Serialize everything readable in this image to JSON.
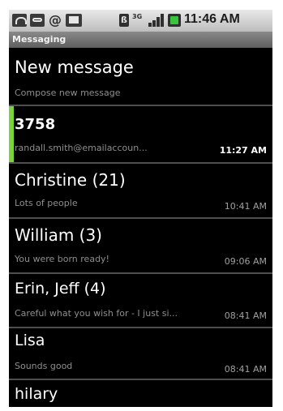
{
  "status_bar": {
    "icons": [
      "phone-icon",
      "voicemail-icon",
      "at-icon",
      "sd-card-icon",
      "bluetooth-icon",
      "3g-icon",
      "signal-icon",
      "battery-icon"
    ],
    "bluetooth_glyph": "ß",
    "network": "3G",
    "at_glyph": "@",
    "time": "11:46 AM"
  },
  "app_title": "Messaging",
  "new_message": {
    "label": "New message",
    "sublabel": "Compose new message"
  },
  "threads": [
    {
      "name": "3758",
      "preview": "randall.smith@emailaccoun...",
      "time": "11:27 AM",
      "unread": true
    },
    {
      "name": "Christine (21)",
      "preview": "Lots of people",
      "time": "10:41 AM",
      "unread": false
    },
    {
      "name": "William (3)",
      "preview": "You were born ready!",
      "time": "09:06 AM",
      "unread": false
    },
    {
      "name": "Erin, Jeff (4)",
      "preview": "Careful what you wish for - I just si...",
      "time": "08:41 AM",
      "unread": false
    },
    {
      "name": "Lisa",
      "preview": "Sounds good",
      "time": "08:41 AM",
      "unread": false
    },
    {
      "name": "hilary",
      "preview": "",
      "time": "",
      "unread": false
    }
  ],
  "colors": {
    "unread_accent": "#7bd23a",
    "battery_fill": "#38c43c",
    "background": "#000000"
  }
}
